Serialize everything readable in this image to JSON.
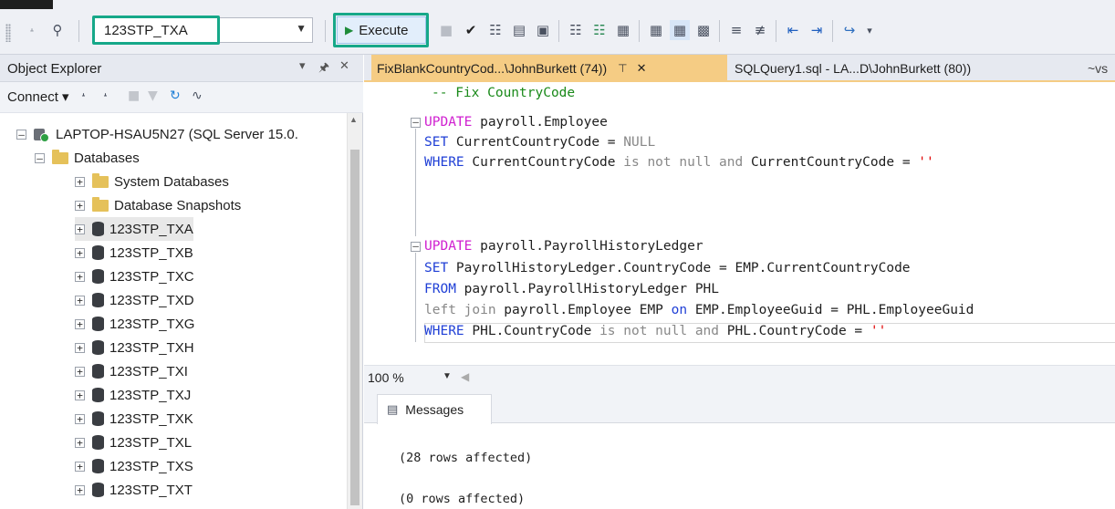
{
  "toolbar": {
    "database_selector": "123STP_TXA",
    "execute_label": "Execute",
    "icons": [
      "plug-icon",
      "connect-icon",
      "stop-icon",
      "parse-checkmark-icon",
      "display-plan-icon",
      "query-options-icon",
      "results-to-grid-icon",
      "comment-icon",
      "indent-icon",
      "specify-values-icon"
    ]
  },
  "object_explorer": {
    "title": "Object Explorer",
    "connect_label": "Connect",
    "tree": {
      "server": "LAPTOP-HSAU5N27 (SQL Server 15.0.",
      "databases_folder": "Databases",
      "folders": [
        "System Databases",
        "Database Snapshots"
      ],
      "databases": [
        "123STP_TXA",
        "123STP_TXB",
        "123STP_TXC",
        "123STP_TXD",
        "123STP_TXG",
        "123STP_TXH",
        "123STP_TXI",
        "123STP_TXJ",
        "123STP_TXK",
        "123STP_TXL",
        "123STP_TXS",
        "123STP_TXT"
      ],
      "selected": "123STP_TXA"
    }
  },
  "tabs": {
    "active": "FixBlankCountryCod...\\JohnBurkett (74))",
    "second": "SQLQuery1.sql - LA...D\\JohnBurkett (80))",
    "third": "~vs"
  },
  "editor": {
    "lines": [
      "-- Fix CountryCode",
      "UPDATE payroll.Employee",
      "SET CurrentCountryCode = NULL",
      "WHERE CurrentCountryCode is not null and CurrentCountryCode = ''",
      "UPDATE payroll.PayrollHistoryLedger",
      "SET PayrollHistoryLedger.CountryCode = EMP.CurrentCountryCode",
      "FROM payroll.PayrollHistoryLedger PHL",
      "left join payroll.Employee EMP on EMP.EmployeeGuid = PHL.EmployeeGuid",
      "WHERE PHL.CountryCode is not null and PHL.CountryCode = ''"
    ],
    "zoom": "100 %"
  },
  "results": {
    "tab_label": "Messages",
    "messages": [
      "(28 rows affected)",
      "(0 rows affected)"
    ]
  },
  "colors": {
    "highlight_box": "#16a889",
    "active_tab": "#f5cc84",
    "keyword": "#1f3fd6",
    "comment": "#1a8a1a",
    "string": "#e00000"
  }
}
